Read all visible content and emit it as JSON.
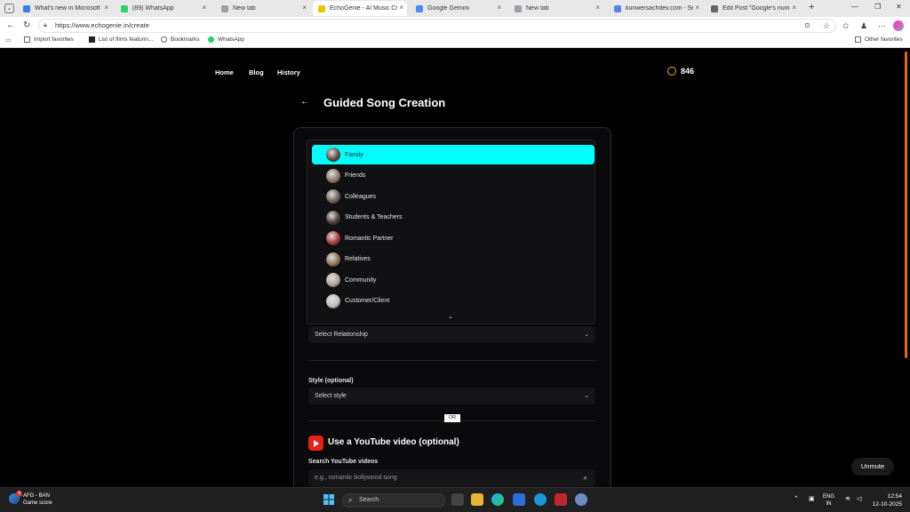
{
  "browser": {
    "tabs": [
      {
        "label": "What's new in Microsoft Ed",
        "color": "#3b7fd6"
      },
      {
        "label": "(89) WhatsApp",
        "color": "#25d366"
      },
      {
        "label": "New tab",
        "color": "#9aa0a6"
      },
      {
        "label": "EchoGenie - AI Music Creat",
        "color": "#e6c700"
      },
      {
        "label": "Google Gemini",
        "color": "#4a8af4"
      },
      {
        "label": "New tab",
        "color": "#9aa0a6"
      },
      {
        "label": "kunwersachdev.com - Sear",
        "color": "#5a7ff0"
      },
      {
        "label": "Edit Post \"Google's num+1",
        "color": "#666666"
      }
    ],
    "active_tab": 3,
    "url": "https://www.echogenie.in/create",
    "bookmarks": [
      "Import favorites",
      "List of films featurin...",
      "Bookmarks",
      "WhatsApp"
    ],
    "other_favorites": "Other favorites"
  },
  "nav": {
    "home": "Home",
    "blog": "Blog",
    "history": "History",
    "credits": "846"
  },
  "page": {
    "back_icon": "←",
    "title": "Guided Song Creation"
  },
  "relationship_dropdown": {
    "options": [
      {
        "label": "Family",
        "selected": true,
        "avatar_color": "#5b4a3a"
      },
      {
        "label": "Friends",
        "selected": false,
        "avatar_color": "#8c7c66"
      },
      {
        "label": "Colleagues",
        "selected": false,
        "avatar_color": "#6d6257"
      },
      {
        "label": "Students & Teachers",
        "selected": false,
        "avatar_color": "#4b3f3a"
      },
      {
        "label": "Romantic Partner",
        "selected": false,
        "avatar_color": "#a33a3a"
      },
      {
        "label": "Relatives",
        "selected": false,
        "avatar_color": "#8d7457"
      },
      {
        "label": "Community",
        "selected": false,
        "avatar_color": "#b0a899"
      },
      {
        "label": "Customer/Client",
        "selected": false,
        "avatar_color": "#c4c1bb"
      }
    ],
    "more_chevron": "⌄",
    "placeholder": "Select Relationship"
  },
  "style": {
    "label": "Style (optional)",
    "placeholder": "Select style"
  },
  "or_text": "OR",
  "youtube": {
    "title": "Use a YouTube video (optional)",
    "search_label": "Search YouTube videos",
    "search_placeholder": "e.g., romantic bollywood song"
  },
  "unmute": "Unmute",
  "taskbar": {
    "weather_line1": "AFG - BAN",
    "weather_line2": "Game score",
    "weather_badge": "4",
    "search": "Search",
    "lang_line1": "ENG",
    "lang_line2": "IN",
    "time": "12:54",
    "date": "12-10-2025"
  }
}
